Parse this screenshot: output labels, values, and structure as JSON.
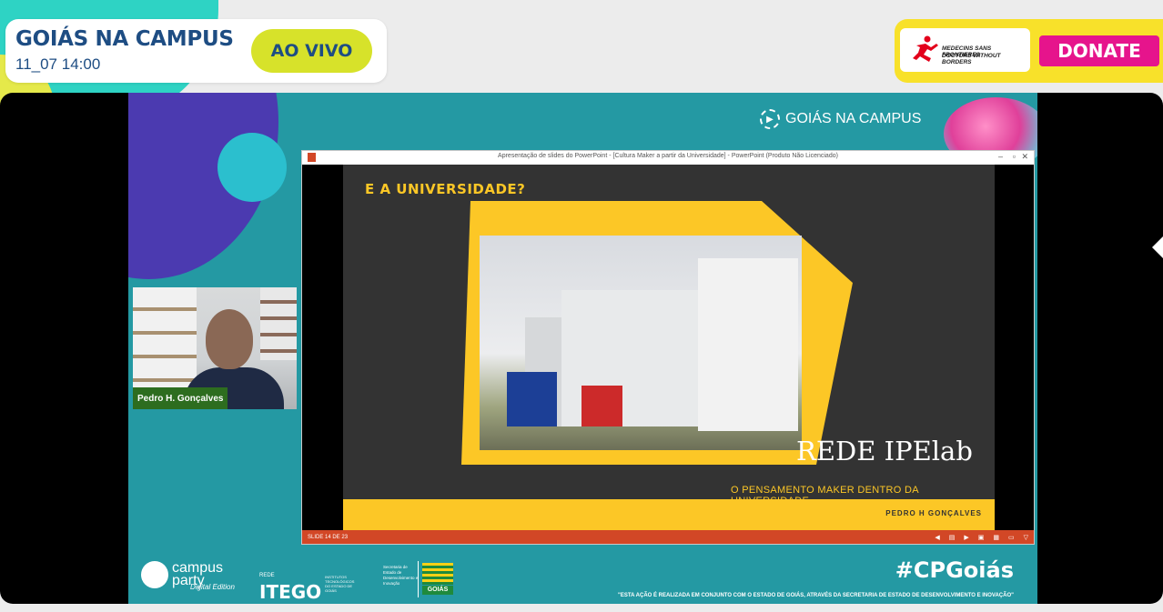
{
  "header": {
    "title": "GOIÁS NA CAMPUS",
    "datetime": "11_07 14:00",
    "live_label": "AO VIVO"
  },
  "donate": {
    "org_line1": "MEDECINS SANS FRONTIERES",
    "org_line2": "DOCTORS WITHOUT BORDERS",
    "button_label": "DONATE"
  },
  "stage": {
    "brand": "GOIÁS NA CAMPUS",
    "speaker_name": "Pedro H. Gonçalves"
  },
  "powerpoint": {
    "window_title": "Apresentação de slides do PowerPoint - [Cultura Maker a partir da Universidade] - PowerPoint (Produto Não Licenciado)",
    "slide_heading": "E A UNIVERSIDADE?",
    "slide_big_text": "REDE IPElab",
    "slide_subtitle": "O PENSAMENTO MAKER DENTRO DA UNIVERSIDADE",
    "slide_author": "PEDRO H GONÇALVES",
    "slide_counter": "SLIDE 14 DE 23"
  },
  "footer": {
    "cp_line1": "campus",
    "cp_line2": "party",
    "cp_digital": "Digital Edition",
    "itego_rede": "REDE",
    "itego_name": "ITEGO",
    "itego_desc": "INSTITUTOS TECNOLÓGICOS DO ESTADO DE GOIÁS",
    "secretaria": "Secretaria de Estado de Desenvolvimento e Inovação",
    "goias": "GOIÁS",
    "hashtag": "#CPGoiás",
    "disclaimer": "\"ESTA AÇÃO É REALIZADA EM CONJUNTO COM O ESTADO DE GOIÁS, ATRAVÉS DA SECRETARIA DE ESTADO DE DESENVOLVIMENTO E INOVAÇÃO\""
  },
  "colors": {
    "brand_blue": "#1e4d83",
    "live_yellow": "#d7e22a",
    "donate_pink": "#e6148c",
    "stage_teal": "#2499a3",
    "slide_yellow": "#fcc726"
  }
}
